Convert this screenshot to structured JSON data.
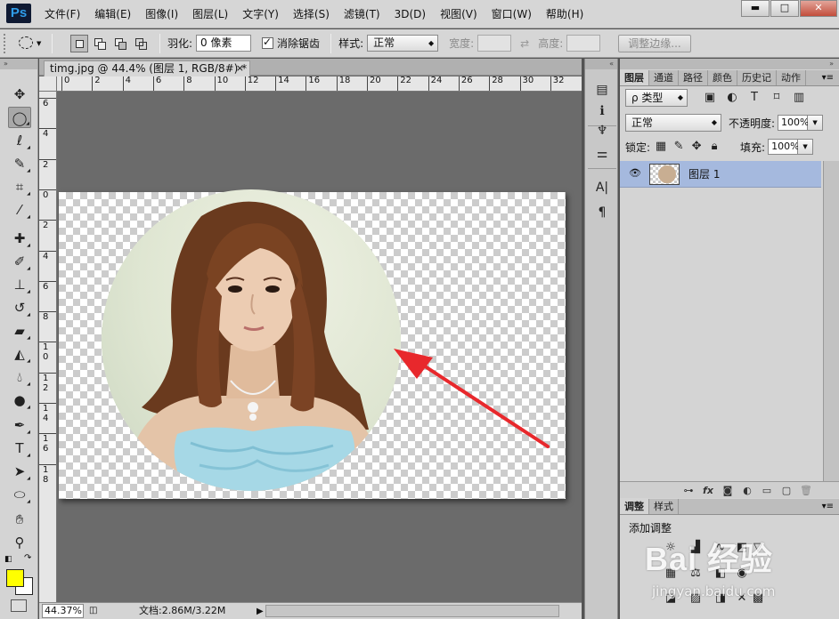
{
  "app": {
    "logo": "Ps"
  },
  "menu": [
    "文件(F)",
    "编辑(E)",
    "图像(I)",
    "图层(L)",
    "文字(Y)",
    "选择(S)",
    "滤镜(T)",
    "3D(D)",
    "视图(V)",
    "窗口(W)",
    "帮助(H)"
  ],
  "window_controls": {
    "minimize": "▬",
    "maximize": "□",
    "close": "✕"
  },
  "options": {
    "feather_label": "羽化:",
    "feather_value": "0 像素",
    "antialias_label": "消除锯齿",
    "antialias_checked": true,
    "style_label": "样式:",
    "style_value": "正常",
    "width_label": "宽度:",
    "height_label": "高度:",
    "refine_edge_label": "调整边缘..."
  },
  "document": {
    "tab_title": "timg.jpg @ 44.4% (图层 1, RGB/8#) *",
    "tab_close": "×",
    "ruler_h": [
      "0",
      "2",
      "4",
      "6",
      "8",
      "10",
      "12",
      "14",
      "16",
      "18",
      "20",
      "22",
      "24",
      "26",
      "28",
      "30",
      "32"
    ],
    "ruler_v": [
      "6",
      "4",
      "2",
      "0",
      "2",
      "4",
      "6",
      "8",
      "1\n0",
      "1\n2",
      "1\n4",
      "1\n6",
      "1\n8"
    ]
  },
  "status": {
    "zoom": "44.37%",
    "doc_size": "文档:2.86M/3.22M"
  },
  "tools": {
    "icons": [
      "move-tool-icon",
      "ellipse-marquee-icon",
      "lasso-icon",
      "quick-selection-icon",
      "crop-icon",
      "eyedropper-icon",
      "healing-brush-icon",
      "brush-icon",
      "clone-stamp-icon",
      "history-brush-icon",
      "eraser-icon",
      "paint-bucket-icon",
      "blur-icon",
      "dodge-icon",
      "pen-icon",
      "type-icon",
      "path-selection-icon",
      "ellipse-shape-icon",
      "hand-icon",
      "zoom-icon"
    ],
    "foreground_color": "#ffff00",
    "background_color": "#ffffff"
  },
  "layers_panel": {
    "tabs": [
      "图层",
      "通道",
      "路径",
      "颜色",
      "历史记",
      "动作"
    ],
    "filter_label": "ρ 类型",
    "blend_mode": "正常",
    "opacity_label": "不透明度:",
    "opacity_value": "100%",
    "lock_label": "锁定:",
    "fill_label": "填充:",
    "fill_value": "100%",
    "layers": [
      {
        "name": "图层 1",
        "visible": true,
        "selected": true
      }
    ],
    "footer_icons": [
      "link-icon",
      "fx-icon",
      "mask-icon",
      "adjustment-icon",
      "folder-icon",
      "new-layer-icon",
      "trash-icon"
    ]
  },
  "adjustments_panel": {
    "tabs": [
      "调整",
      "样式"
    ],
    "title": "添加调整"
  },
  "watermark": {
    "brand": "Bai 经验",
    "url": "jingyan.baidu.com"
  },
  "colors": {
    "accent_arrow": "#e8282c",
    "layer_selected": "#a5b9de"
  }
}
